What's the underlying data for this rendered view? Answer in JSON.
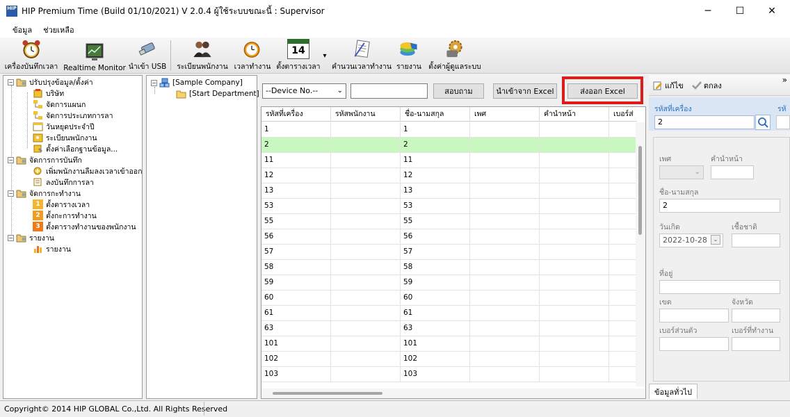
{
  "window": {
    "title": "HIP Premium Time (Build 01/10/2021) V 2.0.4   ผู้ใช้ระบบขณะนี้ : Supervisor",
    "icon_text": "HIP",
    "minimize_icon": "─",
    "maximize_icon": "☐",
    "close_icon": "✕"
  },
  "menu": [
    "ข้อมูล",
    "ช่วยเหลือ"
  ],
  "toolbar": {
    "items": [
      {
        "label": "เครื่องบันทึกเวลา",
        "icon": "alarm-clock-icon"
      },
      {
        "label": "Realtime Monitor",
        "icon": "monitor-icon"
      },
      {
        "label": "นำเข้า USB",
        "icon": "usb-drive-icon"
      },
      {
        "label": "ระเบียนพนักงาน",
        "icon": "employees-icon"
      },
      {
        "label": "เวลาทำงาน",
        "icon": "work-time-icon"
      },
      {
        "label": "ตั้งตารางเวลา",
        "icon": "calendar-icon",
        "calendar_day": "14"
      },
      {
        "label": "คำนวนเวลาทำงาน",
        "icon": "calculate-icon"
      },
      {
        "label": "รายงาน",
        "icon": "report-icon"
      },
      {
        "label": "ตั้งค่าผู้ดูแลระบบ",
        "icon": "admin-settings-icon"
      }
    ],
    "dropdown_glyph": "▾"
  },
  "left_tree": {
    "groups": [
      {
        "label": "ปรับปรุงข้อมูล/ตั้งค่า",
        "expander": "−",
        "children": [
          "บริษัท",
          "จัดการแผนก",
          "จัดการประเภทการลา",
          "วันหยุดประจำปี",
          "ระเบียนพนักงาน",
          "ตั้งค่าเลือกฐานข้อมูล..."
        ]
      },
      {
        "label": "จัดการการบันทึก",
        "expander": "−",
        "children": [
          "เพิ่มพนักงานลืมลงเวลาเข้าออก",
          "ลงบันทึกการลา"
        ]
      },
      {
        "label": "จัดการกะทำงาน",
        "expander": "−",
        "children": [
          "ตั้งตารางเวลา",
          "ตั้งกะการทำงาน",
          "ตั้งตารางทำงานของพนักงาน"
        ],
        "badges": [
          "1",
          "2",
          "3"
        ]
      },
      {
        "label": "รายงาน",
        "expander": "−",
        "children": [
          "รายงาน"
        ]
      }
    ]
  },
  "dept_tree": {
    "company": "[Sample Company]",
    "department": "[Start Department]",
    "expander": "−"
  },
  "main": {
    "device_select": "--Device No.--",
    "search_value": "",
    "search_button": "สอบถาม",
    "import_button": "นำเข้าจาก Excel",
    "export_button": "ส่งออก Excel",
    "columns": [
      "รหัสที่เครื่อง",
      "รหัสพนักงาน",
      "ชื่อ-นามสกุล",
      "เพศ",
      "คำนำหน้า",
      "เบอร์ส่"
    ],
    "rows": [
      [
        "1",
        "",
        "1",
        "",
        "",
        ""
      ],
      [
        "2",
        "",
        "2",
        "",
        "",
        ""
      ],
      [
        "11",
        "",
        "11",
        "",
        "",
        ""
      ],
      [
        "12",
        "",
        "12",
        "",
        "",
        ""
      ],
      [
        "13",
        "",
        "13",
        "",
        "",
        ""
      ],
      [
        "53",
        "",
        "53",
        "",
        "",
        ""
      ],
      [
        "55",
        "",
        "55",
        "",
        "",
        ""
      ],
      [
        "56",
        "",
        "56",
        "",
        "",
        ""
      ],
      [
        "57",
        "",
        "57",
        "",
        "",
        ""
      ],
      [
        "58",
        "",
        "58",
        "",
        "",
        ""
      ],
      [
        "59",
        "",
        "59",
        "",
        "",
        ""
      ],
      [
        "60",
        "",
        "60",
        "",
        "",
        ""
      ],
      [
        "61",
        "",
        "61",
        "",
        "",
        ""
      ],
      [
        "63",
        "",
        "63",
        "",
        "",
        ""
      ],
      [
        "101",
        "",
        "101",
        "",
        "",
        ""
      ],
      [
        "102",
        "",
        "102",
        "",
        "",
        ""
      ],
      [
        "103",
        "",
        "103",
        "",
        "",
        ""
      ]
    ],
    "selected_row": 1,
    "highlight_color": "#e01b1b",
    "selected_row_color": "#c8f7c0"
  },
  "right_panel": {
    "edit_label": "แก้ไข",
    "ok_label": "ตกลง",
    "collapse_glyph": "»",
    "device_code_label": "รหัสที่เครื่อง",
    "device_code_value": "2",
    "cut_label": "รหั",
    "gender_label": "เพศ",
    "title_label": "คำนำหน้า",
    "fullname_label": "ชื่อ-นามสกุล",
    "fullname_value": "2",
    "birthdate_label": "วันเกิด",
    "birthdate_value": "2022-10-28",
    "nationality_label": "เชื้อชาติ",
    "address_label": "ที่อยู่",
    "district_label": "เขต",
    "province_label": "จังหวัด",
    "personal_phone_label": "เบอร์ส่วนตัว",
    "work_phone_label": "เบอร์ที่ทำงาน",
    "tab_label": "ข้อมูลทั่วไป"
  },
  "status": {
    "copyright": "Copyright© 2014 HIP GLOBAL Co.,Ltd. All Rights Reserved"
  }
}
